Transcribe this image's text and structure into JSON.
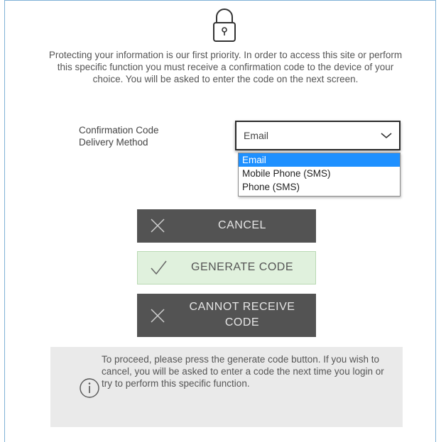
{
  "intro_text": "Protecting your information is our first priority. In order to access this site or perform this specific function you must receive a confirmation code to the device of your choice. You will be asked to enter the code on the next screen.",
  "delivery": {
    "label_line1": "Confirmation Code",
    "label_line2": "Delivery Method",
    "selected_value": "Email",
    "options": [
      "Email",
      "Mobile Phone (SMS)",
      "Phone (SMS)"
    ],
    "highlight_color": "#1e90ff"
  },
  "buttons": {
    "cancel": {
      "label": "CANCEL",
      "icon": "x-icon"
    },
    "generate": {
      "label": "GENERATE CODE",
      "icon": "checkmark-icon"
    },
    "cannot_receive": {
      "label_line1": "CANNOT RECEIVE",
      "label_line2": "CODE",
      "icon": "x-icon"
    }
  },
  "info": {
    "icon": "info-icon",
    "text": "To proceed, please press the generate code button. If you wish to cancel, you will be asked to enter a code the next time you login or try to perform this specific function."
  },
  "colors": {
    "dark_button": "#535353",
    "generate_button": "#e0f1dd",
    "info_panel": "#eaeaea",
    "frame_border": "#7fb1d6"
  }
}
